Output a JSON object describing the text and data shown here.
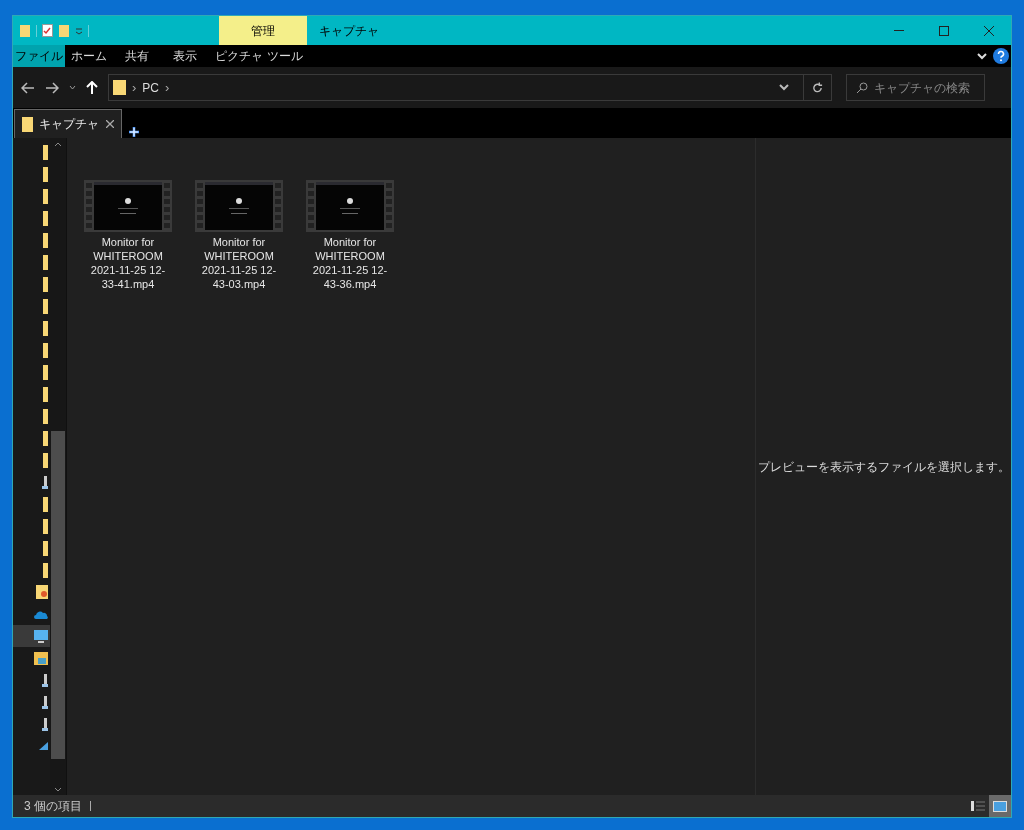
{
  "window": {
    "title": "キャプチャ",
    "context_tab": "管理"
  },
  "ribbon_tabs": [
    {
      "label": "ファイル",
      "selected": true,
      "kind": "file"
    },
    {
      "label": "ホーム",
      "selected": false,
      "kind": "normal"
    },
    {
      "label": "共有",
      "selected": false,
      "kind": "normal"
    },
    {
      "label": "表示",
      "selected": false,
      "kind": "normal"
    },
    {
      "label": "ピクチャ ツール",
      "selected": false,
      "kind": "context"
    }
  ],
  "address": {
    "items": [
      {
        "kind": "separator",
        "text": "›"
      },
      {
        "kind": "crumb",
        "text": "PC"
      },
      {
        "kind": "separator",
        "text": "›"
      }
    ]
  },
  "search": {
    "placeholder": "キャプチャの検索"
  },
  "folder_tabs": [
    {
      "label": "キャプチャ",
      "selected": true
    }
  ],
  "nav_items": [
    {
      "kind": "folder",
      "selected": false
    },
    {
      "kind": "folder",
      "selected": false
    },
    {
      "kind": "folder",
      "selected": false
    },
    {
      "kind": "folder",
      "selected": false
    },
    {
      "kind": "folder",
      "selected": false
    },
    {
      "kind": "folder",
      "selected": false
    },
    {
      "kind": "folder",
      "selected": false
    },
    {
      "kind": "folder",
      "selected": false
    },
    {
      "kind": "folder",
      "selected": false
    },
    {
      "kind": "folder",
      "selected": false
    },
    {
      "kind": "folder",
      "selected": false
    },
    {
      "kind": "folder",
      "selected": false
    },
    {
      "kind": "folder",
      "selected": false
    },
    {
      "kind": "folder",
      "selected": false
    },
    {
      "kind": "folder",
      "selected": false
    },
    {
      "kind": "drive",
      "selected": false
    },
    {
      "kind": "folder",
      "selected": false
    },
    {
      "kind": "folder",
      "selected": false
    },
    {
      "kind": "folder",
      "selected": false
    },
    {
      "kind": "folder",
      "selected": false
    },
    {
      "kind": "quick",
      "selected": false
    },
    {
      "kind": "cloud",
      "selected": false
    },
    {
      "kind": "pc",
      "selected": true
    },
    {
      "kind": "library",
      "selected": false
    },
    {
      "kind": "drive",
      "selected": false
    },
    {
      "kind": "drive",
      "selected": false
    },
    {
      "kind": "drive",
      "selected": false
    },
    {
      "kind": "network",
      "selected": false
    }
  ],
  "files": [
    {
      "name": "Monitor for WHITEROOM 2021-11-25 12-33-41.mp4",
      "selected": false
    },
    {
      "name": "Monitor for WHITEROOM 2021-11-25 12-43-03.mp4",
      "selected": false
    },
    {
      "name": "Monitor for WHITEROOM 2021-11-25 12-43-36.mp4",
      "selected": false
    }
  ],
  "preview": {
    "message": "プレビューを表示するファイルを選択します。"
  },
  "status_bar": {
    "item_count": "3 個の項目"
  },
  "view_buttons": [
    {
      "kind": "details",
      "selected": false
    },
    {
      "kind": "large-icons",
      "selected": true
    }
  ]
}
